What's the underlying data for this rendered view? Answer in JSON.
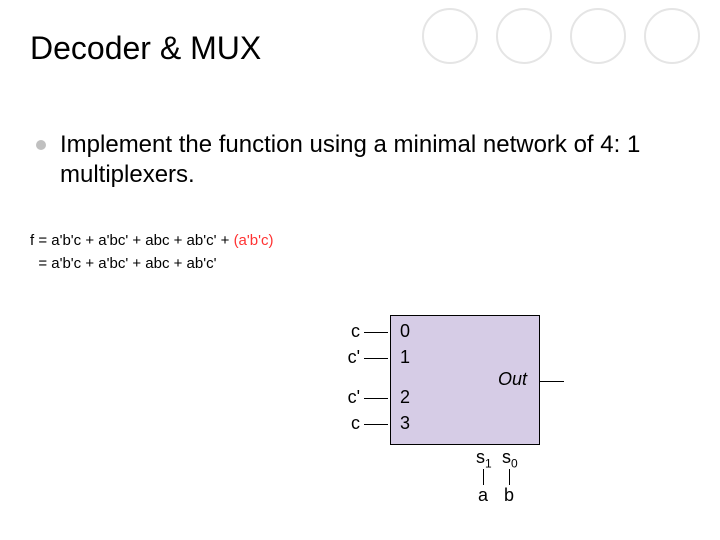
{
  "title": "Decoder & MUX",
  "bullet": "Implement the function using a minimal network of 4: 1 multiplexers.",
  "eq": {
    "line1_pre": "f = a'b'c + a'bc' + abc + ab'c' + ",
    "line1_hl": "(a'b'c)",
    "line2": "  = a'b'c + a'bc' + abc + ab'c'"
  },
  "mux": {
    "inputs": [
      "c",
      "c'",
      "c'",
      "c"
    ],
    "nums": [
      "0",
      "1",
      "2",
      "3"
    ],
    "out": "Out",
    "sel_labels": [
      "s",
      "s"
    ],
    "sel_subs": [
      "1",
      "0"
    ],
    "sel_inputs": [
      "a",
      "b"
    ]
  }
}
